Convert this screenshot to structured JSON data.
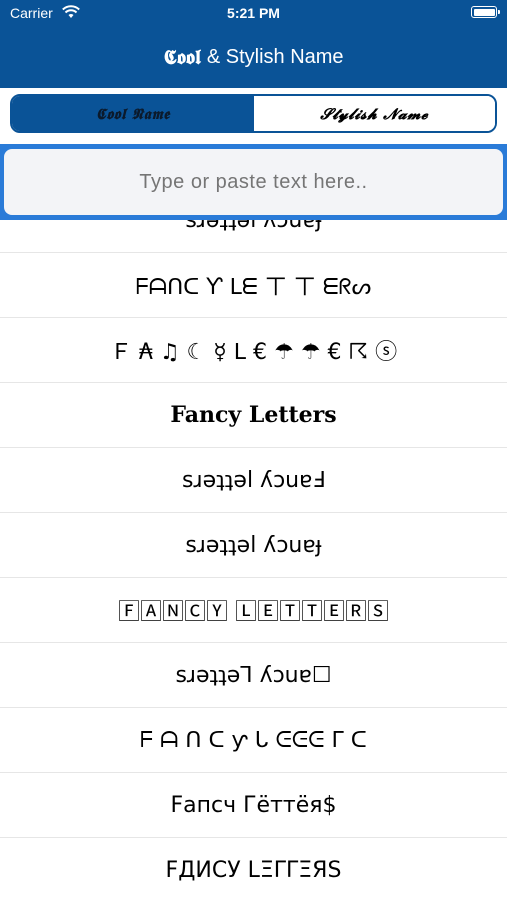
{
  "status_bar": {
    "carrier": "Carrier",
    "time": "5:21 PM"
  },
  "nav": {
    "title_prefix": "𝕮𝖔𝖔𝖑",
    "title_rest": "& Stylish Name"
  },
  "segments": [
    {
      "label": "𝕮𝖔𝖔𝖑 𝕹𝖆𝖒𝖊",
      "active": true
    },
    {
      "label": "𝓢𝓽𝔂𝓵𝓲𝓼𝓱 𝓝𝓪𝓶𝓮",
      "active": false
    }
  ],
  "search": {
    "placeholder": "Type or paste text here.."
  },
  "rows": [
    "sɹǝʇʇǝl ʎɔuɐɟ",
    "ᖴᗩᑎᑕ Ƴ ᒪᗴ ㄒ ㄒ ᗴᖇᔕ",
    "Ｆ ₳ ♫ ☾ ☿ ᒪ € ☂ ☂ € ☈ ⓢ",
    "Fancy Letters",
    "sɹǝʇʇǝl ʎɔuɐℲ",
    "sɹǝʇʇǝl ʎɔuɐɟ",
    "🄵🄰🄽🄲🅈 🄻🄴🅃🅃🄴🅁🅂",
    "sɹǝʇʇǝ⅂ ʎɔuɐ☐",
    "ᖴ ᗩ ᑎ ᑕ ƴ ᒐ ᕮᕮᕮ ᒥ ᑕ",
    "Fапсч Гёттёя$",
    "FДИСУ LΞΓΓΞЯS"
  ]
}
